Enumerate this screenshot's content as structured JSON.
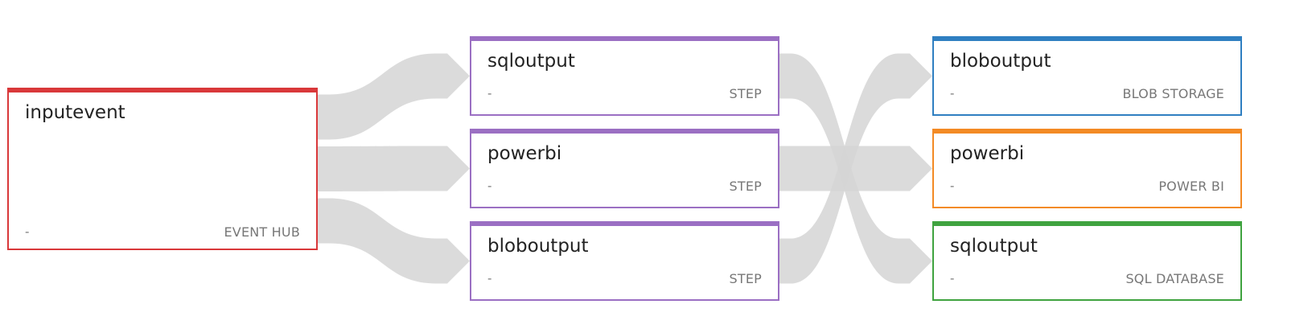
{
  "colors": {
    "flow": "#d5d5d5",
    "event_hub": "#d9383a",
    "step": "#9b6fc3",
    "blob_storage": "#2f7fc1",
    "power_bi": "#f38a24",
    "sql_database": "#3fa33f"
  },
  "nodes": {
    "input": {
      "name": "inputevent",
      "detail": "-",
      "kind": "EVENT HUB"
    },
    "step_sql": {
      "name": "sqloutput",
      "detail": "-",
      "kind": "STEP"
    },
    "step_powerbi": {
      "name": "powerbi",
      "detail": "-",
      "kind": "STEP"
    },
    "step_blob": {
      "name": "bloboutput",
      "detail": "-",
      "kind": "STEP"
    },
    "out_blob": {
      "name": "bloboutput",
      "detail": "-",
      "kind": "BLOB STORAGE"
    },
    "out_powerbi": {
      "name": "powerbi",
      "detail": "-",
      "kind": "POWER BI"
    },
    "out_sql": {
      "name": "sqloutput",
      "detail": "-",
      "kind": "SQL DATABASE"
    }
  },
  "edges": [
    {
      "from": "input",
      "to": "step_sql"
    },
    {
      "from": "input",
      "to": "step_powerbi"
    },
    {
      "from": "input",
      "to": "step_blob"
    },
    {
      "from": "step_sql",
      "to": "out_sql"
    },
    {
      "from": "step_powerbi",
      "to": "out_powerbi"
    },
    {
      "from": "step_blob",
      "to": "out_blob"
    }
  ]
}
